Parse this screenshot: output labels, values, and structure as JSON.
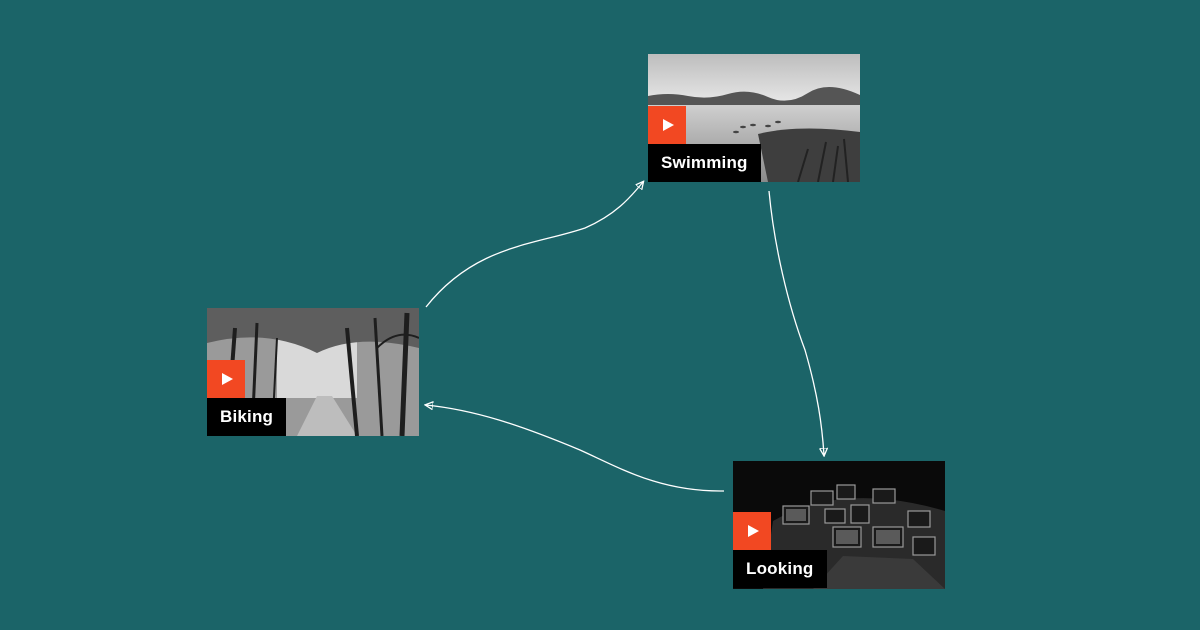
{
  "colors": {
    "background": "#1b6468",
    "play_button": "#f24822",
    "label_background": "#000000",
    "label_text": "#ffffff",
    "arrow": "#ffffff"
  },
  "cards": [
    {
      "id": "swimming",
      "label": "Swimming",
      "icon": "play-icon",
      "scene": "lake"
    },
    {
      "id": "biking",
      "label": "Biking",
      "icon": "play-icon",
      "scene": "forest"
    },
    {
      "id": "looking",
      "label": "Looking",
      "icon": "play-icon",
      "scene": "screens"
    }
  ],
  "connections": [
    {
      "from": "biking",
      "to": "swimming"
    },
    {
      "from": "swimming",
      "to": "looking"
    },
    {
      "from": "looking",
      "to": "biking"
    }
  ]
}
